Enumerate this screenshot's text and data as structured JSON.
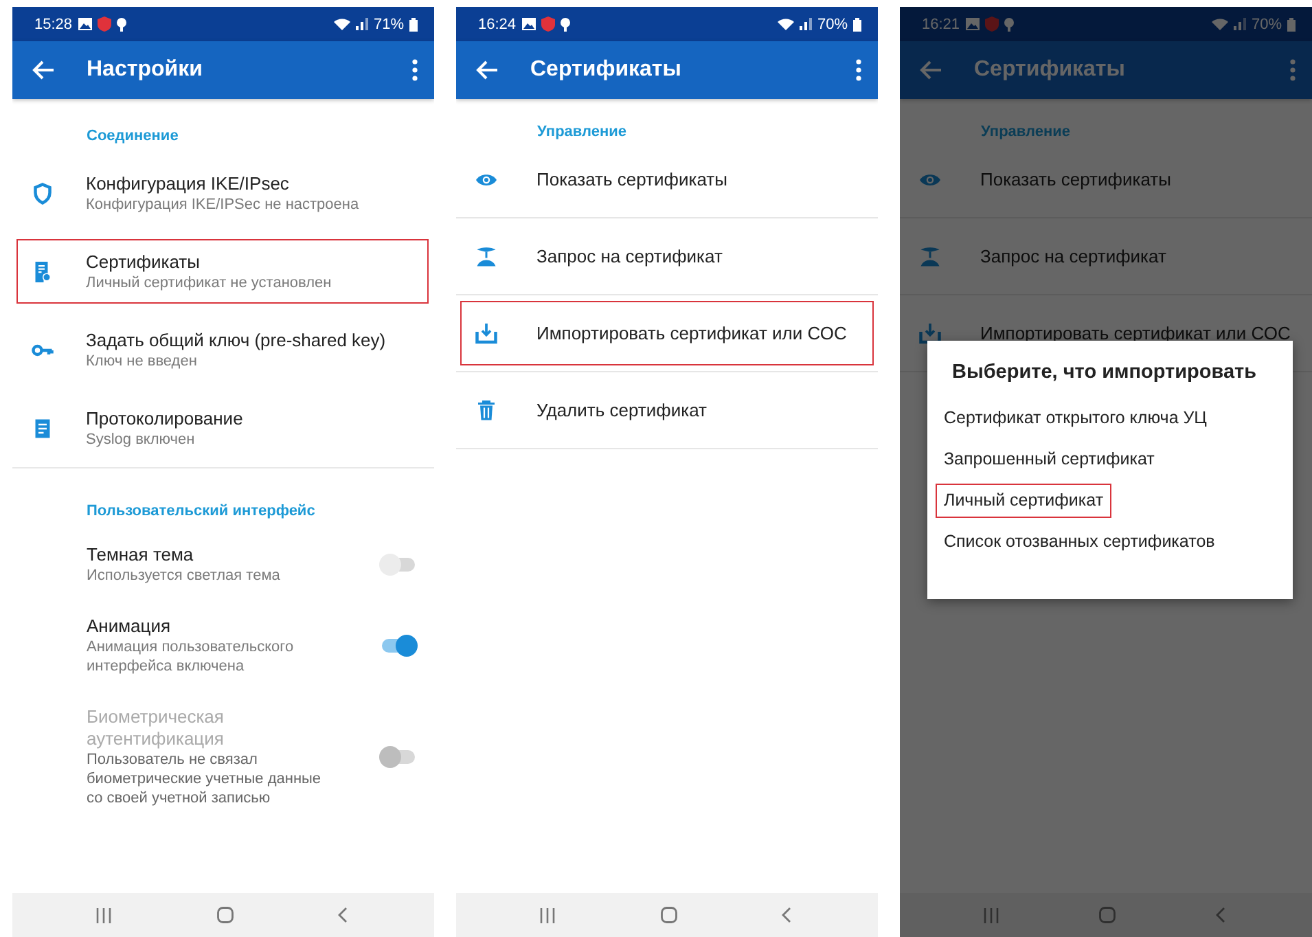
{
  "screens": [
    {
      "status_bar": {
        "time": "15:28",
        "battery": "71%"
      },
      "app_bar": {
        "title": "Настройки"
      },
      "sections": [
        {
          "header": "Соединение",
          "items": [
            {
              "kind": "link",
              "title": "Конфигурация IKE/IPsec",
              "subtitle": "Конфигурация IKE/IPSec не настроена",
              "highlighted": false
            },
            {
              "kind": "link",
              "title": "Сертификаты",
              "subtitle": "Личный сертификат не установлен",
              "highlighted": true
            },
            {
              "kind": "link",
              "title": "Задать общий ключ (pre-shared key)",
              "subtitle": "Ключ не введен",
              "highlighted": false
            },
            {
              "kind": "link",
              "title": "Протоколирование",
              "subtitle": "Syslog включен",
              "highlighted": false
            }
          ]
        },
        {
          "header": "Пользовательский интерфейс",
          "items": [
            {
              "kind": "switch",
              "title": "Темная тема",
              "subtitle": "Используется светлая тема",
              "on": false,
              "disabled": false
            },
            {
              "kind": "switch",
              "title": "Анимация",
              "subtitle": "Анимация пользовательского интерфейса включена",
              "on": true,
              "disabled": false
            },
            {
              "kind": "switch",
              "title": "Биометрическая аутентификация",
              "subtitle": "Пользователь не связал биометрические учетные данные со своей учетной записью",
              "on": false,
              "disabled": true
            }
          ]
        }
      ]
    },
    {
      "status_bar": {
        "time": "16:24",
        "battery": "70%"
      },
      "app_bar": {
        "title": "Сертификаты"
      },
      "sections": [
        {
          "header": "Управление",
          "items": [
            {
              "kind": "action",
              "title": "Показать сертификаты",
              "highlighted": false
            },
            {
              "kind": "action",
              "title": "Запрос на сертификат",
              "highlighted": false
            },
            {
              "kind": "action",
              "title": "Импортировать сертификат или СОС",
              "highlighted": true
            },
            {
              "kind": "action",
              "title": "Удалить сертификат",
              "highlighted": false
            }
          ]
        }
      ]
    },
    {
      "status_bar": {
        "time": "16:21",
        "battery": "70%"
      },
      "app_bar": {
        "title": "Сертификаты"
      },
      "sections": [
        {
          "header": "Управление",
          "items": [
            {
              "kind": "action",
              "title": "Показать сертификаты",
              "highlighted": false
            },
            {
              "kind": "action",
              "title": "Запрос на сертификат",
              "highlighted": false
            },
            {
              "kind": "action",
              "title": "Импортировать сертификат или СОС",
              "highlighted": false
            }
          ]
        }
      ],
      "dialog": {
        "title": "Выберите, что импортировать",
        "options": [
          {
            "label": "Сертификат открытого ключа УЦ",
            "highlighted": false
          },
          {
            "label": "Запрошенный сертификат",
            "highlighted": false
          },
          {
            "label": "Личный сертификат",
            "highlighted": true
          },
          {
            "label": "Список отозванных сертификатов",
            "highlighted": false
          }
        ]
      }
    }
  ]
}
